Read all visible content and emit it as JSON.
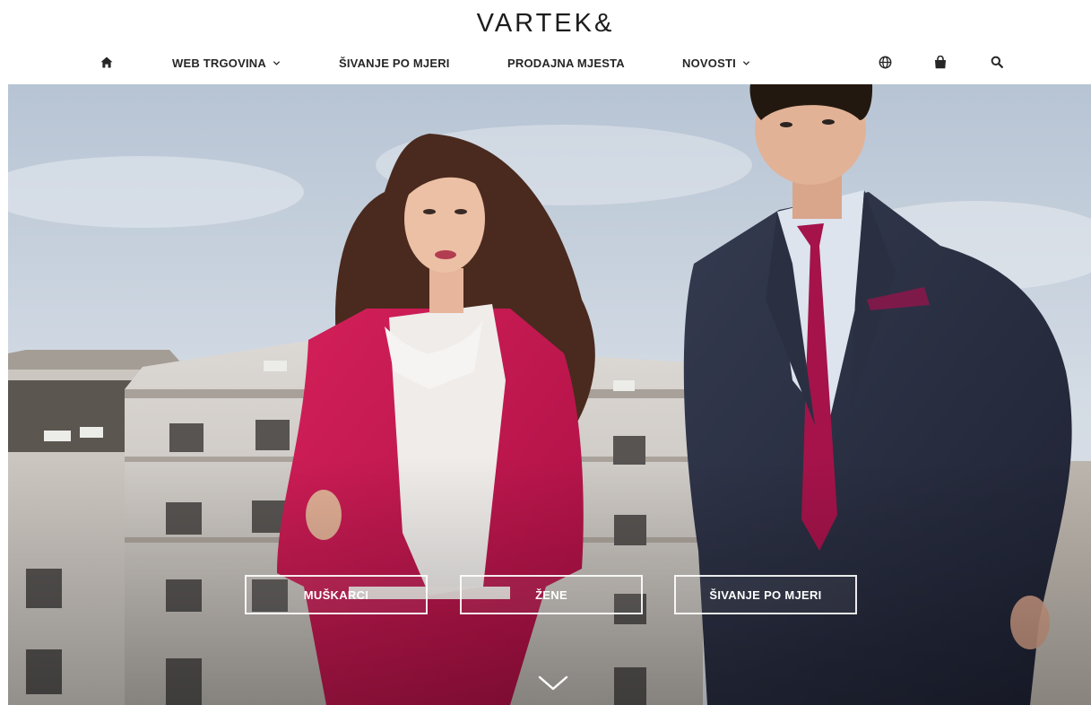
{
  "brand": {
    "logo_text": "VARTEK&"
  },
  "nav": {
    "home_icon": "home-icon",
    "items": [
      {
        "label": "WEB TRGOVINA",
        "has_dropdown": true
      },
      {
        "label": "ŠIVANJE PO MJERI",
        "has_dropdown": false
      },
      {
        "label": "PRODAJNA MJESTA",
        "has_dropdown": false
      },
      {
        "label": "NOVOSTI",
        "has_dropdown": true
      }
    ],
    "right_icons": [
      "globe-icon",
      "shopping-bag-icon",
      "search-icon"
    ]
  },
  "hero": {
    "buttons": [
      {
        "label": "MUŠKARCI"
      },
      {
        "label": "ŽENE"
      },
      {
        "label": "ŠIVANJE PO MJERI"
      }
    ],
    "scroll_icon": "chevron-down-icon"
  },
  "colors": {
    "text_dark": "#262626",
    "jacket_red": "#c8154f",
    "suit_navy": "#262b3d",
    "tie_magenta": "#a5134a",
    "sky": "#c9d4e0",
    "building": "#d9d6d2"
  }
}
